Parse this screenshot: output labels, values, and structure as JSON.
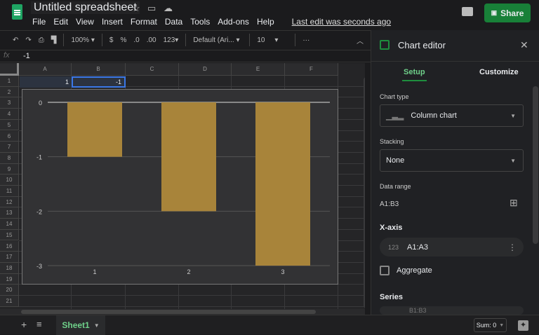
{
  "app": {
    "title": "Untitled spreadsheet",
    "menu": [
      "File",
      "Edit",
      "View",
      "Insert",
      "Format",
      "Data",
      "Tools",
      "Add-ons",
      "Help"
    ],
    "last_edit": "Last edit was seconds ago",
    "share": "Share",
    "accent": "#188038"
  },
  "toolbar": {
    "zoom": "100%",
    "currency": "$",
    "percent": "%",
    "dec_less": ".0",
    "dec_more": ".00",
    "format": "123",
    "font": "Default (Ari...",
    "font_size": "10",
    "more": "···"
  },
  "formula": {
    "fx": "fx",
    "value": "-1"
  },
  "grid": {
    "columns": [
      "A",
      "B",
      "C",
      "D",
      "E",
      "F"
    ],
    "rows": [
      "1",
      "2",
      "3",
      "4",
      "5",
      "6",
      "7",
      "8",
      "9",
      "10",
      "11",
      "12",
      "13",
      "14",
      "15",
      "16",
      "17",
      "18",
      "19",
      "20",
      "21"
    ],
    "cells": {
      "A1": "1",
      "B1": "-1"
    }
  },
  "chart_data": {
    "type": "bar",
    "categories": [
      "1",
      "2",
      "3"
    ],
    "values": [
      -1,
      -2,
      -3
    ],
    "ylim": [
      -3,
      0
    ],
    "yticks": [
      "0",
      "-1",
      "-2",
      "-3"
    ],
    "color": "#a8843a",
    "grid": true
  },
  "editor": {
    "title": "Chart editor",
    "tabs": [
      "Setup",
      "Customize"
    ],
    "chart_type_label": "Chart type",
    "chart_type": "Column chart",
    "stacking_label": "Stacking",
    "stacking": "None",
    "data_range_label": "Data range",
    "data_range": "A1:B3",
    "xaxis_label": "X-axis",
    "xaxis_range": "A1:A3",
    "xaxis_type": "123",
    "aggregate": "Aggregate",
    "series_label": "Series",
    "series_range": "B1:B3"
  },
  "bottom": {
    "sheet": "Sheet1",
    "sum": "Sum: 0"
  }
}
